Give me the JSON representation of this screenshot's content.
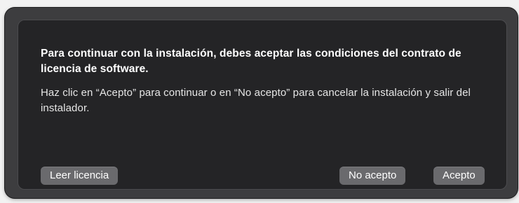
{
  "dialog": {
    "headline": "Para continuar con la instalación, debes aceptar las condiciones del contrato de licencia de software.",
    "body": "Haz clic en “Acepto” para continuar o en “No acepto” para cancelar la instalación y salir del instalador."
  },
  "buttons": {
    "read_license": "Leer licencia",
    "decline": "No acepto",
    "accept": "Acepto"
  },
  "colors": {
    "frame": "#3d3d3f",
    "sheet_background": "#242426",
    "button": "#6a6a6d",
    "text": "#ffffff"
  }
}
